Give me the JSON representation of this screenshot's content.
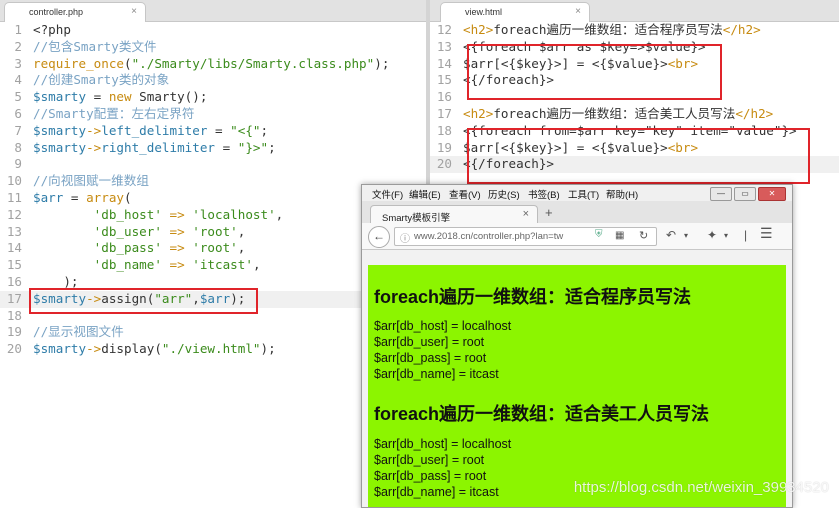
{
  "left_editor": {
    "tab_label": "controller.php",
    "close_glyph": "×",
    "lines": [
      {
        "n": "1",
        "tokens": [
          {
            "t": "<?php",
            "c": "c-plain"
          }
        ]
      },
      {
        "n": "2",
        "tokens": [
          {
            "t": "//包含Smarty类文件",
            "c": "c-cmt"
          }
        ]
      },
      {
        "n": "3",
        "tokens": [
          {
            "t": "require_once",
            "c": "c-kw"
          },
          {
            "t": "(",
            "c": "c-plain"
          },
          {
            "t": "\"./Smarty/libs/Smarty.class.php\"",
            "c": "c-str"
          },
          {
            "t": ");",
            "c": "c-plain"
          }
        ]
      },
      {
        "n": "4",
        "tokens": [
          {
            "t": "//创建Smarty类的对象",
            "c": "c-cmt"
          }
        ]
      },
      {
        "n": "5",
        "tokens": [
          {
            "t": "$smarty",
            "c": "c-var"
          },
          {
            "t": " = ",
            "c": "c-plain"
          },
          {
            "t": "new",
            "c": "c-kw"
          },
          {
            "t": " Smarty();",
            "c": "c-plain"
          }
        ]
      },
      {
        "n": "6",
        "tokens": [
          {
            "t": "//Smarty配置：左右定界符",
            "c": "c-cmt"
          }
        ]
      },
      {
        "n": "7",
        "tokens": [
          {
            "t": "$smarty",
            "c": "c-var"
          },
          {
            "t": "->",
            "c": "c-kw"
          },
          {
            "t": "left_delimiter",
            "c": "c-var"
          },
          {
            "t": " = ",
            "c": "c-plain"
          },
          {
            "t": "\"<{\"",
            "c": "c-str"
          },
          {
            "t": ";",
            "c": "c-plain"
          }
        ]
      },
      {
        "n": "8",
        "tokens": [
          {
            "t": "$smarty",
            "c": "c-var"
          },
          {
            "t": "->",
            "c": "c-kw"
          },
          {
            "t": "right_delimiter",
            "c": "c-var"
          },
          {
            "t": " = ",
            "c": "c-plain"
          },
          {
            "t": "\"}>\"",
            "c": "c-str"
          },
          {
            "t": ";",
            "c": "c-plain"
          }
        ]
      },
      {
        "n": "9",
        "tokens": []
      },
      {
        "n": "10",
        "tokens": [
          {
            "t": "//向视图赋一维数组",
            "c": "c-cmt"
          }
        ]
      },
      {
        "n": "11",
        "tokens": [
          {
            "t": "$arr",
            "c": "c-var"
          },
          {
            "t": " = ",
            "c": "c-plain"
          },
          {
            "t": "array",
            "c": "c-kw"
          },
          {
            "t": "(",
            "c": "c-plain"
          }
        ]
      },
      {
        "n": "12",
        "tokens": [
          {
            "t": "        ",
            "c": "c-plain"
          },
          {
            "t": "'db_host'",
            "c": "c-str"
          },
          {
            "t": " => ",
            "c": "c-kw"
          },
          {
            "t": "'localhost'",
            "c": "c-str"
          },
          {
            "t": ",",
            "c": "c-plain"
          }
        ]
      },
      {
        "n": "13",
        "tokens": [
          {
            "t": "        ",
            "c": "c-plain"
          },
          {
            "t": "'db_user'",
            "c": "c-str"
          },
          {
            "t": " => ",
            "c": "c-kw"
          },
          {
            "t": "'root'",
            "c": "c-str"
          },
          {
            "t": ",",
            "c": "c-plain"
          }
        ]
      },
      {
        "n": "14",
        "tokens": [
          {
            "t": "        ",
            "c": "c-plain"
          },
          {
            "t": "'db_pass'",
            "c": "c-str"
          },
          {
            "t": " => ",
            "c": "c-kw"
          },
          {
            "t": "'root'",
            "c": "c-str"
          },
          {
            "t": ",",
            "c": "c-plain"
          }
        ]
      },
      {
        "n": "15",
        "tokens": [
          {
            "t": "        ",
            "c": "c-plain"
          },
          {
            "t": "'db_name'",
            "c": "c-str"
          },
          {
            "t": " => ",
            "c": "c-kw"
          },
          {
            "t": "'itcast'",
            "c": "c-str"
          },
          {
            "t": ",",
            "c": "c-plain"
          }
        ]
      },
      {
        "n": "16",
        "tokens": [
          {
            "t": "    );",
            "c": "c-plain"
          }
        ]
      },
      {
        "n": "17",
        "tokens": [
          {
            "t": "$smarty",
            "c": "c-var"
          },
          {
            "t": "->",
            "c": "c-kw"
          },
          {
            "t": "assign(",
            "c": "c-plain"
          },
          {
            "t": "\"arr\"",
            "c": "c-str"
          },
          {
            "t": ",",
            "c": "c-plain"
          },
          {
            "t": "$arr",
            "c": "c-var"
          },
          {
            "t": ");",
            "c": "c-plain"
          }
        ]
      },
      {
        "n": "18",
        "tokens": []
      },
      {
        "n": "19",
        "tokens": [
          {
            "t": "//显示视图文件",
            "c": "c-cmt"
          }
        ]
      },
      {
        "n": "20",
        "tokens": [
          {
            "t": "$smarty",
            "c": "c-var"
          },
          {
            "t": "->",
            "c": "c-kw"
          },
          {
            "t": "display(",
            "c": "c-plain"
          },
          {
            "t": "\"./view.html\"",
            "c": "c-str"
          },
          {
            "t": ");",
            "c": "c-plain"
          }
        ]
      }
    ],
    "current_line": "17"
  },
  "right_editor": {
    "tab_label": "view.html",
    "close_glyph": "×",
    "lines": [
      {
        "n": "12",
        "tokens": [
          {
            "t": "<h2>",
            "c": "c-tag"
          },
          {
            "t": "foreach遍历一维数组：适合程序员写法",
            "c": "c-plain"
          },
          {
            "t": "</h2>",
            "c": "c-tag"
          }
        ]
      },
      {
        "n": "13",
        "tokens": [
          {
            "t": "<{foreach $arr as $key=>$value}>",
            "c": "c-plain"
          }
        ]
      },
      {
        "n": "14",
        "tokens": [
          {
            "t": "$arr[<{$key}>] = <{$value}>",
            "c": "c-plain"
          },
          {
            "t": "<br>",
            "c": "c-tag"
          }
        ]
      },
      {
        "n": "15",
        "tokens": [
          {
            "t": "<{/foreach}>",
            "c": "c-plain"
          }
        ]
      },
      {
        "n": "16",
        "tokens": []
      },
      {
        "n": "17",
        "tokens": [
          {
            "t": "<h2>",
            "c": "c-tag"
          },
          {
            "t": "foreach遍历一维数组：适合美工人员写法",
            "c": "c-plain"
          },
          {
            "t": "</h2>",
            "c": "c-tag"
          }
        ]
      },
      {
        "n": "18",
        "tokens": [
          {
            "t": "<{foreach from=$arr key=\"key\" item=\"value\"}>",
            "c": "c-plain"
          }
        ]
      },
      {
        "n": "19",
        "tokens": [
          {
            "t": "$arr[<{$key}>] = <{$value}>",
            "c": "c-plain"
          },
          {
            "t": "<br>",
            "c": "c-tag"
          }
        ]
      },
      {
        "n": "20",
        "tokens": [
          {
            "t": "<{/foreach}>",
            "c": "c-plain"
          }
        ]
      }
    ],
    "current_line": "20"
  },
  "browser": {
    "menu": [
      "文件(F)",
      "编辑(E)",
      "查看(V)",
      "历史(S)",
      "书签(B)",
      "工具(T)",
      "帮助(H)"
    ],
    "window_buttons": {
      "minimize": "—",
      "maximize": "▭",
      "close": "✕"
    },
    "tab_title": "Smarty模板引擎",
    "tab_close": "×",
    "new_tab": "+",
    "url": "www.2018.cn/controller.php?lan=tw",
    "icons": {
      "back": "back-arrow-icon",
      "info": "info-icon",
      "shield": "shield-icon",
      "qr": "qr-code-icon",
      "reload": "reload-icon"
    },
    "page": {
      "heading1": "foreach遍历一维数组：适合程序员写法",
      "block1": [
        "$arr[db_host] = localhost",
        "$arr[db_user] = root",
        "$arr[db_pass] = root",
        "$arr[db_name] = itcast"
      ],
      "heading2": "foreach遍历一维数组：适合美工人员写法",
      "block2": [
        "$arr[db_host] = localhost",
        "$arr[db_user] = root",
        "$arr[db_pass] = root",
        "$arr[db_name] = itcast"
      ]
    },
    "page_background": "#8cf500"
  },
  "watermark": "https://blog.csdn.net/weixin_39934520",
  "highlight_color": "#e0242a"
}
